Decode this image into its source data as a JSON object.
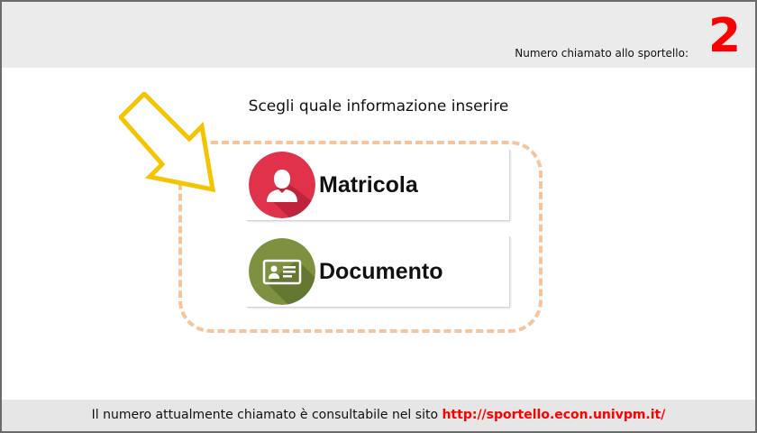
{
  "header": {
    "label": "Numero chiamato allo sportello:",
    "called_number": "2",
    "number_color": "#ff0000"
  },
  "main": {
    "prompt": "Scegli quale informazione inserire",
    "arrow_color": "#f5c400",
    "dashed_border_color": "#f7c49b",
    "options": [
      {
        "label": "Matricola",
        "icon": "user-icon",
        "icon_color": "#e0324a"
      },
      {
        "label": "Documento",
        "icon": "id-card-icon",
        "icon_color": "#7d9140"
      }
    ]
  },
  "footer": {
    "text": "Il numero attualmente chiamato è consultabile nel sito",
    "link_text": "http://sportello.econ.univpm.it/",
    "link_color": "#ff0000"
  }
}
